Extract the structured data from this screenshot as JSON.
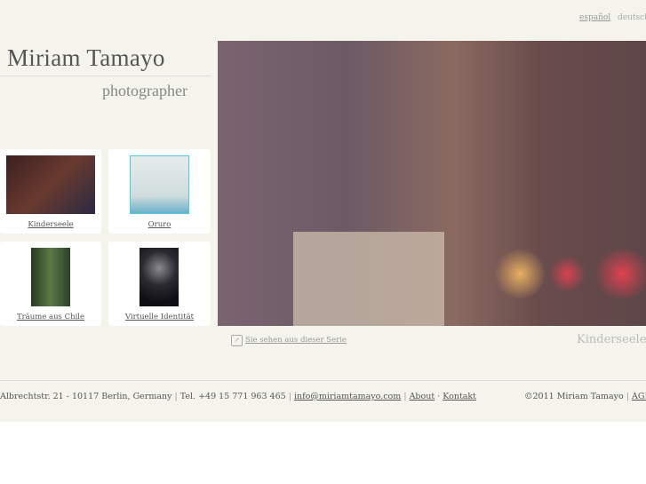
{
  "languages": [
    {
      "label": "español"
    },
    {
      "label": "deutsch"
    }
  ],
  "header": {
    "title": "Miriam Tamayo",
    "subtitle": "photographer"
  },
  "series": [
    {
      "label": "Kinderseele"
    },
    {
      "label": "Oruro"
    },
    {
      "label": "Träume aus Chile"
    },
    {
      "label": "Virtuelle Identität"
    }
  ],
  "viewer": {
    "series_link": "Sie sehen aus dieser Serie",
    "caption": "Kinderseele"
  },
  "footer": {
    "address": "Albrechtstr. 21 - 10117 Berlin, Germany",
    "phone": "Tel. +49 15 771 963 465",
    "email": "info@miriamtamayo.com",
    "about": "About",
    "contact": "Kontakt",
    "copyright": "©2011 Miriam Tamayo",
    "agb": "AGB"
  }
}
